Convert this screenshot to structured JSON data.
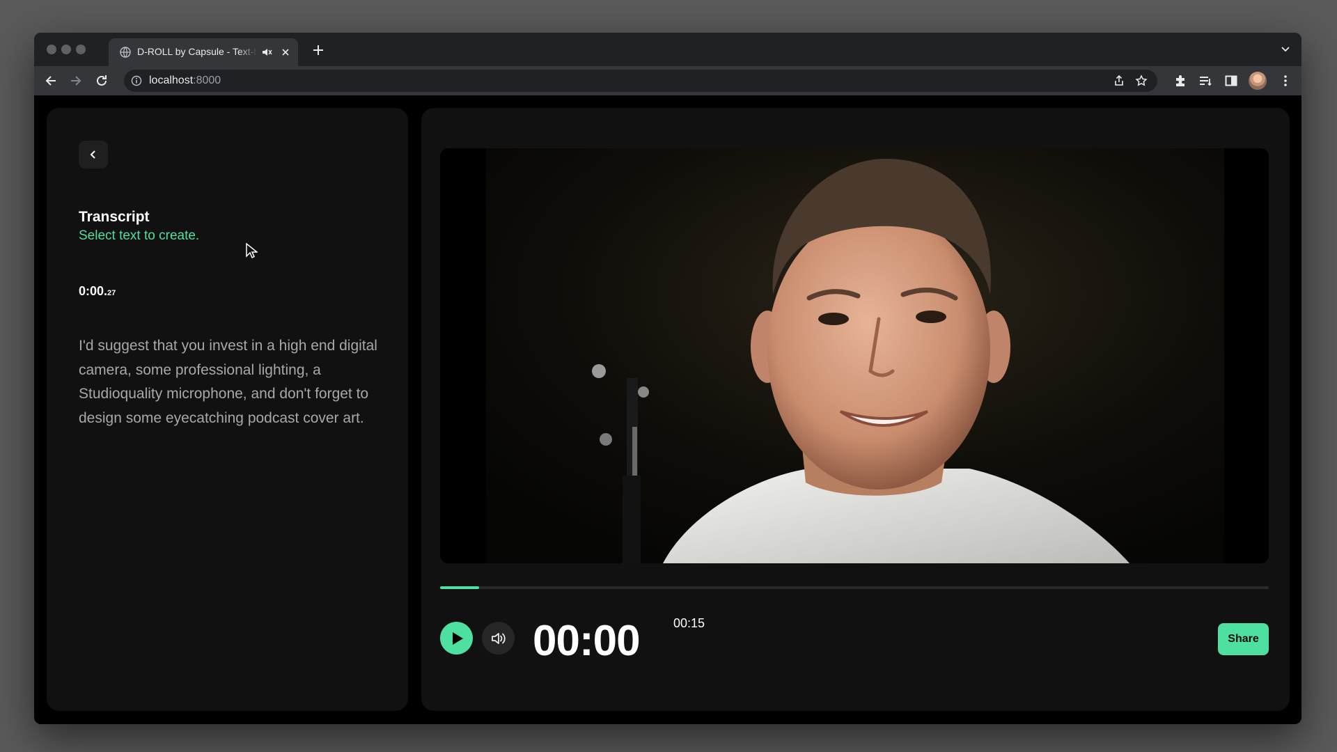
{
  "browser": {
    "tab_title": "D-ROLL by Capsule - Text-based video editing",
    "url_host": "localhost",
    "url_port": ":8000"
  },
  "transcript": {
    "title": "Transcript",
    "subtitle": "Select text to create.",
    "timestamp_main": "0:00.",
    "timestamp_frac": "27",
    "body": "I'd suggest that you invest in a high end digital camera, some professional lighting, a Studioquality microphone, and don't forget to design some eyecatching podcast cover art."
  },
  "player": {
    "current_time": "00:00",
    "duration": "00:15",
    "progress_fraction": 0.047,
    "share_label": "Share"
  },
  "colors": {
    "accent": "#4ee0a0",
    "panel": "#111111",
    "page": "#000000"
  },
  "icons": [
    "back-icon",
    "play-icon",
    "volume-icon",
    "globe-icon",
    "mute-icon",
    "close-icon",
    "plus-icon",
    "info-icon",
    "share-page-icon",
    "star-icon",
    "extensions-icon",
    "reading-list-icon",
    "side-panel-icon",
    "more-icon",
    "chevron-down-icon"
  ]
}
